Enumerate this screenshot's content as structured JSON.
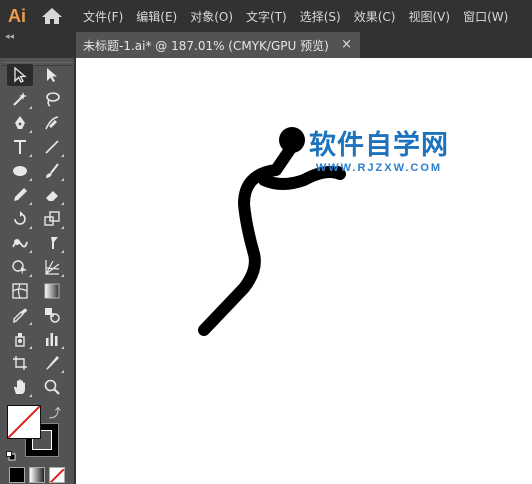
{
  "app": {
    "logo": "Ai"
  },
  "menu": [
    "文件(F)",
    "编辑(E)",
    "对象(O)",
    "文字(T)",
    "选择(S)",
    "效果(C)",
    "视图(V)",
    "窗口(W)"
  ],
  "tabs": [
    {
      "title": "未标题-1.ai* @ 187.01% (CMYK/GPU 预览)",
      "close": "×"
    }
  ],
  "panel": {
    "collapse": "◂◂"
  },
  "tools": [
    "selection-tool",
    "direct-selection-tool",
    "magic-wand-tool",
    "lasso-tool",
    "pen-tool",
    "curvature-tool",
    "type-tool",
    "line-segment-tool",
    "ellipse-tool",
    "paintbrush-tool",
    "pencil-tool",
    "eraser-tool",
    "rotate-tool",
    "scale-tool",
    "warp-tool",
    "puppet-warp-tool",
    "shape-builder-tool",
    "perspective-grid-tool",
    "mesh-tool",
    "gradient-tool",
    "eyedropper-tool",
    "blend-tool",
    "symbol-sprayer-tool",
    "column-graph-tool",
    "artboard-tool",
    "slice-tool",
    "hand-tool",
    "zoom-tool"
  ],
  "colors": {
    "fill": "none",
    "stroke": "#000000",
    "accent": "#f29d4b"
  },
  "watermark": {
    "main": "软件自学网",
    "sub": "WWW.RJZXW.COM"
  }
}
